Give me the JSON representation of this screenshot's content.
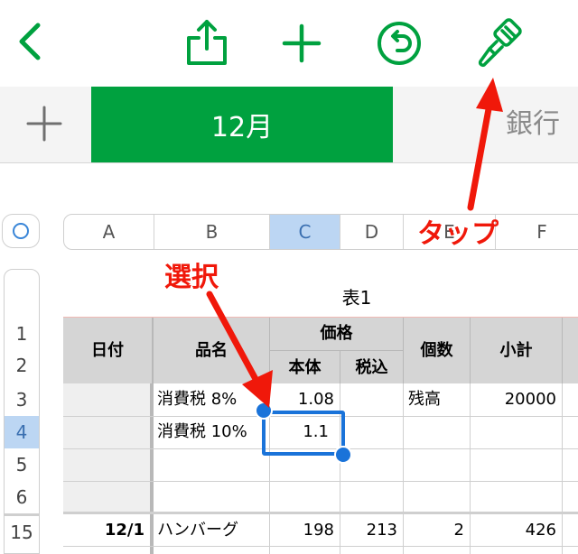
{
  "colors": {
    "accent": "#00a13f",
    "annotation": "#f0180a",
    "selection": "#1a73d9"
  },
  "toolbar": {
    "icons": [
      "back-chevron-icon",
      "share-icon",
      "add-icon",
      "undo-icon",
      "format-brush-icon"
    ]
  },
  "tabs": {
    "add_icon": "plus-icon",
    "active_label": "12月",
    "next_label": "銀行"
  },
  "sheet": {
    "columns": [
      "A",
      "B",
      "C",
      "D",
      "E",
      "F"
    ],
    "selected_column": "C",
    "rows": [
      "1",
      "2",
      "3",
      "4",
      "5",
      "6",
      "15"
    ],
    "selected_row": "4",
    "table_title": "表1",
    "header": {
      "date": "日付",
      "item": "品名",
      "price": "価格",
      "base": "本体",
      "tax_incl": "税込",
      "count": "個数",
      "subtotal": "小計"
    },
    "row3": {
      "item": "消費税  8%",
      "base": "1.08",
      "count": "残高",
      "subtotal": "20000"
    },
    "row4": {
      "item": "消費税  10%",
      "base": "1.1"
    },
    "row15": {
      "date": "12/1",
      "item": "ハンバーグ",
      "base": "198",
      "tax_incl": "213",
      "count": "2",
      "subtotal": "426"
    }
  },
  "annotations": {
    "tap": "タップ",
    "select": "選択"
  }
}
